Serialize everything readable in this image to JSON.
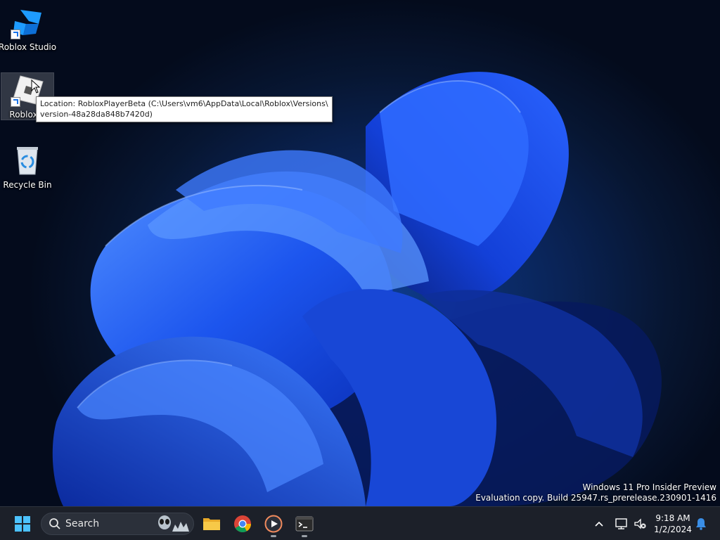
{
  "desktop": {
    "icons": [
      {
        "label": "Roblox Studio",
        "icon": "roblox-studio-icon"
      },
      {
        "label": "Roblox P",
        "icon": "roblox-player-icon",
        "selected": true
      },
      {
        "label": "Recycle Bin",
        "icon": "recycle-bin-icon"
      }
    ],
    "tooltip": {
      "line1": "Location: RobloxPlayerBeta (C:\\Users\\vm6\\AppData\\Local\\Roblox\\Versions\\",
      "line2": "version-48a28da848b7420d)"
    },
    "watermark": {
      "line1": "Windows 11 Pro Insider Preview",
      "line2": "Evaluation copy. Build 25947.rs_prerelease.230901-1416"
    }
  },
  "taskbar": {
    "search_placeholder": "Search",
    "pinned": [
      "start-icon",
      "file-explorer-icon",
      "chrome-icon",
      "media-player-icon",
      "terminal-icon"
    ],
    "tray": {
      "time": "9:18 AM",
      "date": "1/2/2024"
    }
  },
  "colors": {
    "wallpaper_bloom": "#1f5cf0",
    "taskbar": "#1c2029",
    "accent": "#3a8ee6"
  }
}
